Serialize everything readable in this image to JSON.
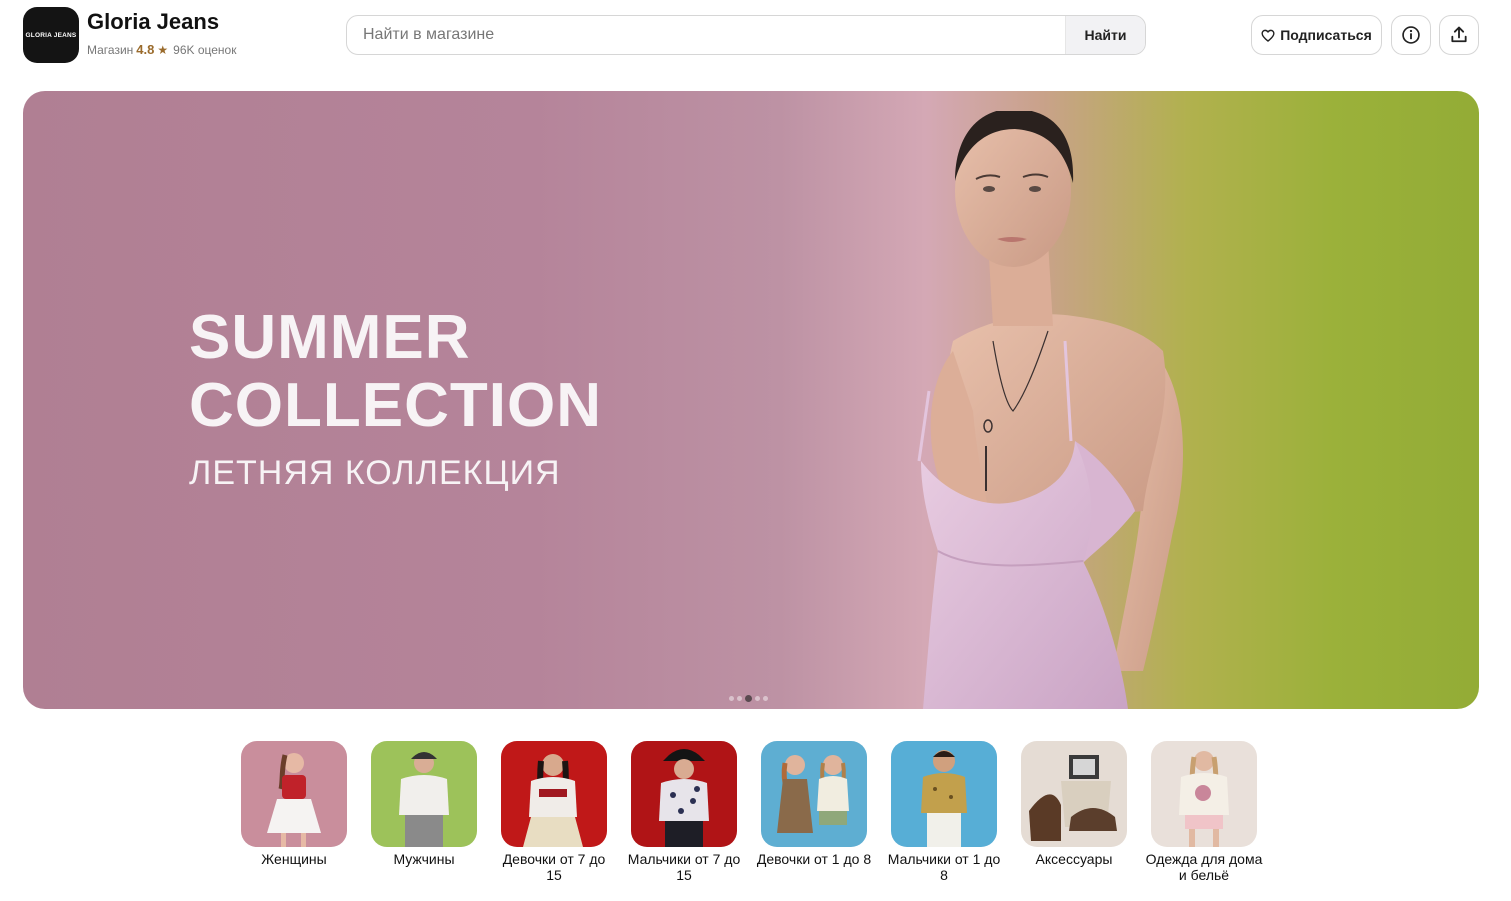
{
  "header": {
    "logo_text": "GLORIA JEANS",
    "store_name": "Gloria Jeans",
    "store_type": "Магазин",
    "rating": "4.8",
    "reviews": "96K оценок",
    "search_placeholder": "Найти в магазине",
    "search_button": "Найти",
    "subscribe_label": "Подписаться",
    "info_icon": "info-icon",
    "share_icon": "share-icon"
  },
  "banner": {
    "title_line1": "SUMMER",
    "title_line2": "COLLECTION",
    "subtitle": "ЛЕТНЯЯ КОЛЛЕКЦИЯ",
    "slides_total": 5,
    "active_slide": 3
  },
  "categories": [
    {
      "label": "Женщины",
      "bg": "#c98e9c"
    },
    {
      "label": "Мужчины",
      "bg": "#9dc25a"
    },
    {
      "label": "Девочки от 7 до 15",
      "bg": "#c01818"
    },
    {
      "label": "Мальчики от 7 до 15",
      "bg": "#b01416"
    },
    {
      "label": "Девочки от 1 до 8",
      "bg": "#5eaed2"
    },
    {
      "label": "Мальчики от 1 до 8",
      "bg": "#57aed6"
    },
    {
      "label": "Аксессуары",
      "bg": "#e5dcd4"
    },
    {
      "label": "Одежда для дома и бельё",
      "bg": "#e9e0da"
    }
  ],
  "colors": {
    "accent_rating": "#9a6b2c",
    "banner_pink": "#b07f93",
    "banner_green": "#93ac36"
  }
}
